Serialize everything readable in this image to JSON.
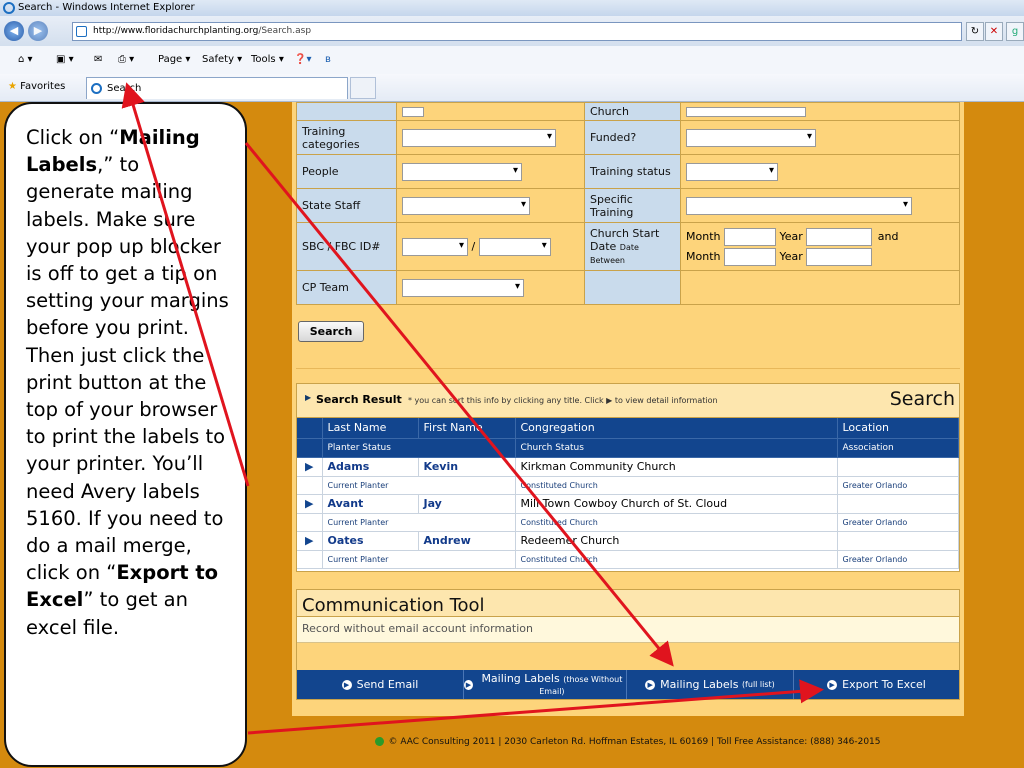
{
  "browser": {
    "window_title": "Search - Windows Internet Explorer",
    "url_domain": "http://www.floridachurchplanting.org",
    "url_path": "/Search.asp",
    "command_items": [
      "Page ▾",
      "Safety ▾",
      "Tools ▾"
    ],
    "favorites_label": "Favorites",
    "tab_title": "Search"
  },
  "form": {
    "rows": [
      {
        "left_label": "",
        "right_label": "Church"
      },
      {
        "left_label": "Training categories",
        "right_label": "Funded?"
      },
      {
        "left_label": "People",
        "right_label": "Training status"
      },
      {
        "left_label": "State Staff",
        "right_label": "Specific Training"
      },
      {
        "left_label": "SBC / FBC ID#",
        "right_label": "Church Start",
        "right_label_small": "Date Between"
      },
      {
        "left_label": "CP Team",
        "right_label": ""
      }
    ],
    "date_fields": {
      "month": "Month",
      "year": "Year",
      "and": "and"
    },
    "id_separator": "/",
    "search_button": "Search"
  },
  "results": {
    "title": "Search Result",
    "note": "* you can sort this info by clicking any title. Click ▶ to view detail information",
    "big_label": "Search",
    "headers": [
      "Last Name",
      "First Name",
      "Congregation",
      "Location"
    ],
    "subheaders": [
      "Planter Status",
      "",
      "Church Status",
      "Association"
    ],
    "rows": [
      {
        "last": "Adams",
        "first": "Kevin",
        "congregation": "Kirkman Community Church",
        "location": "",
        "status": "Current Planter",
        "church_status": "Constituted Church",
        "association": "Greater Orlando"
      },
      {
        "last": "Avant",
        "first": "Jay",
        "congregation": "Mill Town Cowboy Church of St. Cloud",
        "location": "",
        "status": "Current Planter",
        "church_status": "Constituted Church",
        "association": "Greater Orlando"
      },
      {
        "last": "Oates",
        "first": "Andrew",
        "congregation": "Redeemer Church",
        "location": "",
        "status": "Current Planter",
        "church_status": "Constituted Church",
        "association": "Greater Orlando"
      }
    ]
  },
  "communication": {
    "title": "Communication Tool",
    "note": "Record without email account information",
    "actions": {
      "send_email": "Send Email",
      "mailing_labels_without": "Mailing Labels",
      "mailing_labels_without_small": "(those Without Email)",
      "mailing_labels_full": "Mailing Labels",
      "mailing_labels_full_small": "(full list)",
      "export": "Export To Excel"
    }
  },
  "footer": "© AAC Consulting 2011 | 2030 Carleton Rd. Hoffman Estates, IL 60169 | Toll Free Assistance: (888) 346-2015",
  "callout": {
    "p1": "Click on “",
    "b1": "Mailing Labels",
    "p2": ",” to generate mailing labels.  Make sure your pop up blocker is off to get a tip on setting your margins before you print.  Then just click the print button at the top of your browser to print the labels to your printer.  You’ll need Avery labels 5160. If you need to do a mail merge, click on “",
    "b2": "Export to Excel",
    "p3": "” to get an excel file."
  },
  "colors": {
    "arrow": "#e0141e",
    "header_blue": "#12458e",
    "page_bg": "#fdd47b",
    "outer_bg": "#d48a0e"
  }
}
